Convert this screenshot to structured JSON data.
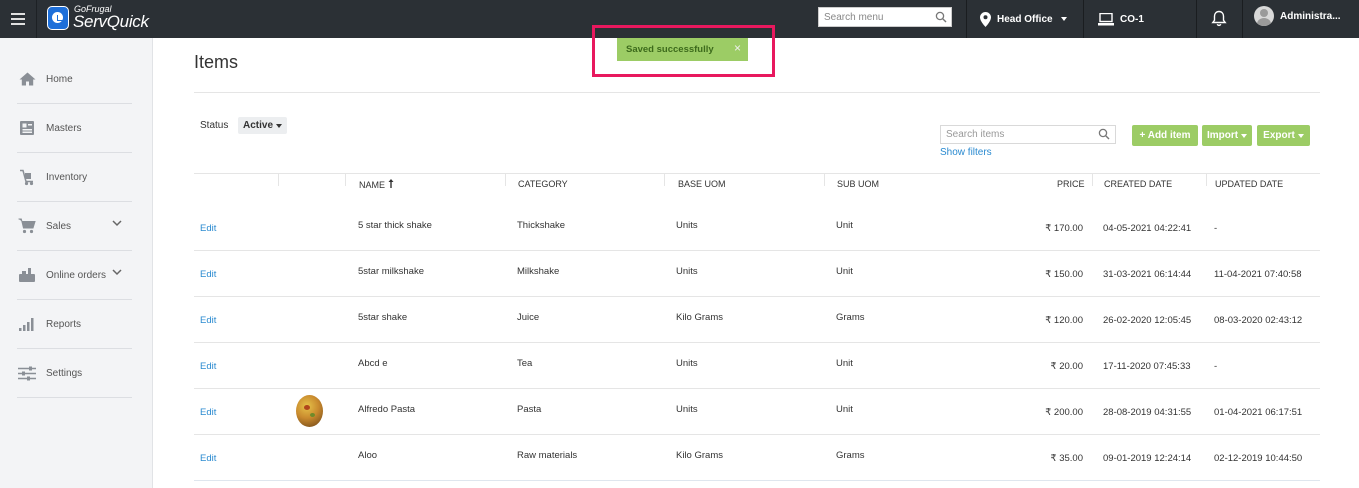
{
  "topbar": {
    "logo_small": "GoFrugal",
    "logo_big": "ServQuick",
    "search_placeholder": "Search menu",
    "branch": "Head Office",
    "counter": "CO-1",
    "user": "Administra..."
  },
  "sidebar": {
    "items": [
      {
        "label": "Home",
        "icon": "home-icon"
      },
      {
        "label": "Masters",
        "icon": "masters-icon"
      },
      {
        "label": "Inventory",
        "icon": "inventory-icon"
      },
      {
        "label": "Sales",
        "icon": "cart-icon"
      },
      {
        "label": "Online orders",
        "icon": "online-orders-icon"
      },
      {
        "label": "Reports",
        "icon": "bar-chart-icon"
      },
      {
        "label": "Settings",
        "icon": "sliders-icon"
      }
    ]
  },
  "page": {
    "title": "Items",
    "toast": "Saved successfully",
    "toast_close": "×",
    "status_label": "Status",
    "status_value": "Active",
    "search_placeholder": "Search items",
    "show_filters": "Show filters",
    "add_item": "+ Add item",
    "import": "Import",
    "export": "Export"
  },
  "table": {
    "columns": [
      "NAME",
      "CATEGORY",
      "BASE UOM",
      "SUB UOM",
      "PRICE",
      "CREATED DATE",
      "UPDATED DATE"
    ],
    "edit_label": "Edit",
    "rows": [
      {
        "name": "5 star thick shake",
        "category": "Thickshake",
        "base_uom": "Units",
        "sub_uom": "Unit",
        "price": "₹ 170.00",
        "created": "04-05-2021 04:22:41",
        "updated": "-",
        "has_image": false
      },
      {
        "name": "5star milkshake",
        "category": "Milkshake",
        "base_uom": "Units",
        "sub_uom": "Unit",
        "price": "₹ 150.00",
        "created": "31-03-2021 06:14:44",
        "updated": "11-04-2021 07:40:58",
        "has_image": false
      },
      {
        "name": "5star shake",
        "category": "Juice",
        "base_uom": "Kilo Grams",
        "sub_uom": "Grams",
        "price": "₹ 120.00",
        "created": "26-02-2020 12:05:45",
        "updated": "08-03-2020 02:43:12",
        "has_image": false
      },
      {
        "name": "Abcd e",
        "category": "Tea",
        "base_uom": "Units",
        "sub_uom": "Unit",
        "price": "₹ 20.00",
        "created": "17-11-2020 07:45:33",
        "updated": "-",
        "has_image": false
      },
      {
        "name": "Alfredo Pasta",
        "category": "Pasta",
        "base_uom": "Units",
        "sub_uom": "Unit",
        "price": "₹ 200.00",
        "created": "28-08-2019 04:31:55",
        "updated": "01-04-2021 06:17:51",
        "has_image": true
      },
      {
        "name": "Aloo",
        "category": "Raw materials",
        "base_uom": "Kilo Grams",
        "sub_uom": "Grams",
        "price": "₹ 35.00",
        "created": "09-01-2019 12:24:14",
        "updated": "02-12-2019 10:44:50",
        "has_image": false
      }
    ]
  },
  "colors": {
    "topbar": "#2b3035",
    "accent_green": "#9ccc65",
    "link_blue": "#2a8ad0",
    "highlight": "#e8185e"
  }
}
